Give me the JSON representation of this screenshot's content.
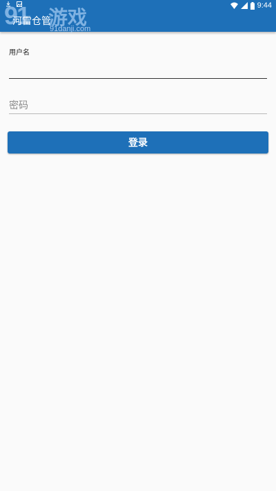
{
  "status_bar": {
    "time": "9:44",
    "icons": [
      "download-icon",
      "image-icon",
      "wifi-icon",
      "signal-icon",
      "battery-icon"
    ]
  },
  "watermark": {
    "big": "91",
    "cn": "游戏",
    "url": "91danji.com"
  },
  "appbar": {
    "title": "河雷仓管",
    "color": "#1e70b8"
  },
  "form": {
    "username": {
      "label": "用户名",
      "value": ""
    },
    "password": {
      "placeholder": "密码",
      "value": ""
    },
    "login_label": "登录"
  },
  "colors": {
    "primary": "#1e70b8",
    "background": "#fafafa"
  }
}
